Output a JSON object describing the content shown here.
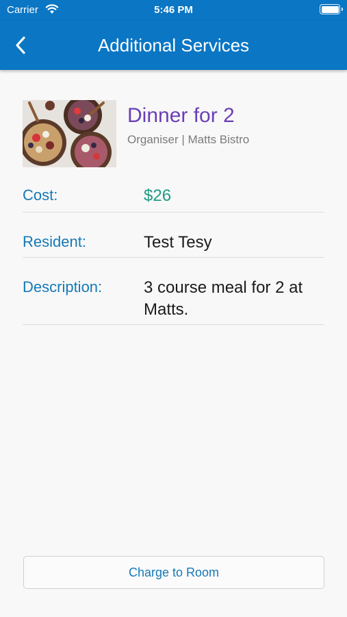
{
  "status_bar": {
    "carrier": "Carrier",
    "time": "5:46 PM",
    "wifi_icon": "wifi-icon",
    "battery_icon": "battery-icon",
    "battery_level": 1.0
  },
  "nav": {
    "title": "Additional Services",
    "back_icon": "chevron-left-icon"
  },
  "service": {
    "title": "Dinner for 2",
    "organiser": "Organiser | Matts Bistro",
    "image_icon": "food-photo"
  },
  "details": {
    "cost_label": "Cost:",
    "cost_value": "$26",
    "resident_label": "Resident:",
    "resident_value": "Test Tesy",
    "description_label": "Description:",
    "description_value": "3 course meal for 2 at Matts."
  },
  "actions": {
    "charge_label": "Charge to Room"
  },
  "colors": {
    "accent": "#0a76c4",
    "title_purple": "#6a3fb6",
    "label_blue": "#1479b8",
    "cost_green": "#1e9b83"
  }
}
